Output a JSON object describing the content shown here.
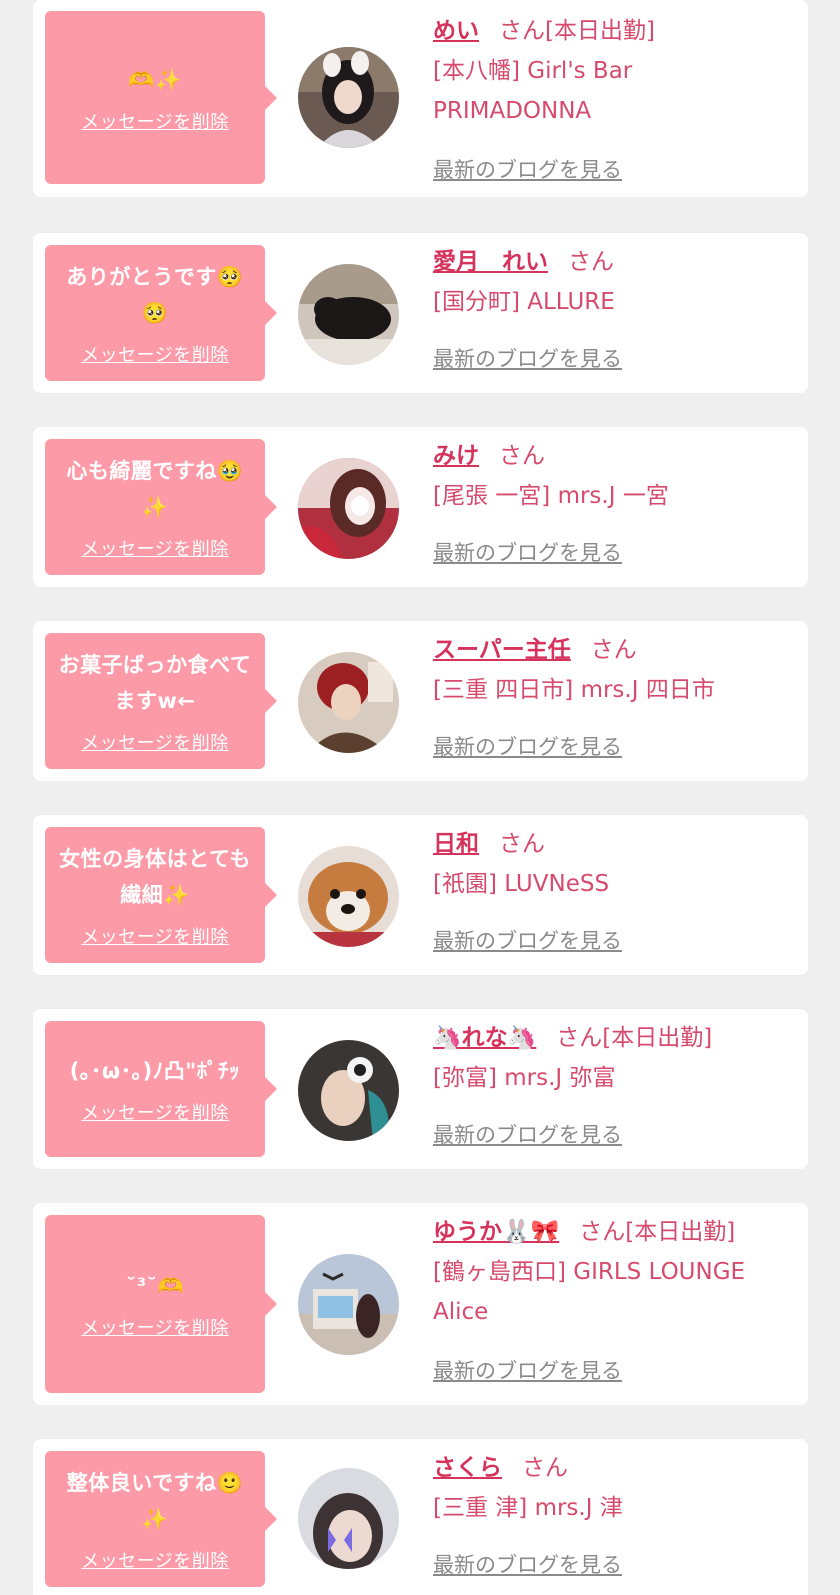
{
  "cards": [
    {
      "message": "🫶✨",
      "delete_label": "メッセージを削除",
      "name": "めい",
      "honorific": "さん[本日出勤]",
      "shop": "[本八幡] Girl's Bar PRIMADONNA",
      "blog_link": "最新のブログを見る",
      "avatar_icon": "girl-with-bunny-ears-photo"
    },
    {
      "message": "ありがとうです🥺🥺",
      "delete_label": "メッセージを削除",
      "name": "愛月　れい",
      "honorific": "さん",
      "shop": "[国分町] ALLURE",
      "blog_link": "最新のブログを見る",
      "avatar_icon": "black-cat-photo"
    },
    {
      "message": "心も綺麗ですね🥹✨",
      "delete_label": "メッセージを削除",
      "name": "みけ",
      "honorific": "さん",
      "shop": "[尾張 一宮] mrs.J 一宮",
      "blog_link": "最新のブログを見る",
      "avatar_icon": "girl-selfie-photo"
    },
    {
      "message": "お菓子ばっか食べてますw←",
      "delete_label": "メッセージを削除",
      "name": "スーパー主任",
      "honorific": "さん",
      "shop": "[三重 四日市] mrs.J 四日市",
      "blog_link": "最新のブログを見る",
      "avatar_icon": "red-hair-person-photo"
    },
    {
      "message": "女性の身体はとても繊細✨",
      "delete_label": "メッセージを削除",
      "name": "日和",
      "honorific": "さん",
      "shop": "[祇園] LUVNeSS",
      "blog_link": "最新のブログを見る",
      "avatar_icon": "dog-photo"
    },
    {
      "message": "(｡･ω･｡)ﾉ凸\"ﾎﾟﾁｯ",
      "delete_label": "メッセージを削除",
      "name": "🦄れな🦄",
      "honorific": "さん[本日出勤]",
      "shop": "[弥富] mrs.J 弥富",
      "blog_link": "最新のブログを見る",
      "avatar_icon": "girl-with-hair-clip-photo"
    },
    {
      "message": "˘³˘🫶",
      "delete_label": "メッセージを削除",
      "name": "ゆうか🐰🎀",
      "honorific": "さん[本日出勤]",
      "shop": "[鶴ヶ島西口] GIRLS LOUNGE Alice",
      "blog_link": "最新のブログを見る",
      "avatar_icon": "theme-park-photo"
    },
    {
      "message": "整体良いですね🙂✨",
      "delete_label": "メッセージを削除",
      "name": "さくら",
      "honorific": "さん",
      "shop": "[三重 津] mrs.J 津",
      "blog_link": "最新のブログを見る",
      "avatar_icon": "girl-with-butterfly-photo"
    }
  ],
  "colors": {
    "page_bg": "#efefef",
    "card_bg": "#ffffff",
    "bubble_bg": "#fd9aa8",
    "name": "#d6335c",
    "shop_text": "#d64b6d",
    "blog_link": "#8a8a8a"
  }
}
